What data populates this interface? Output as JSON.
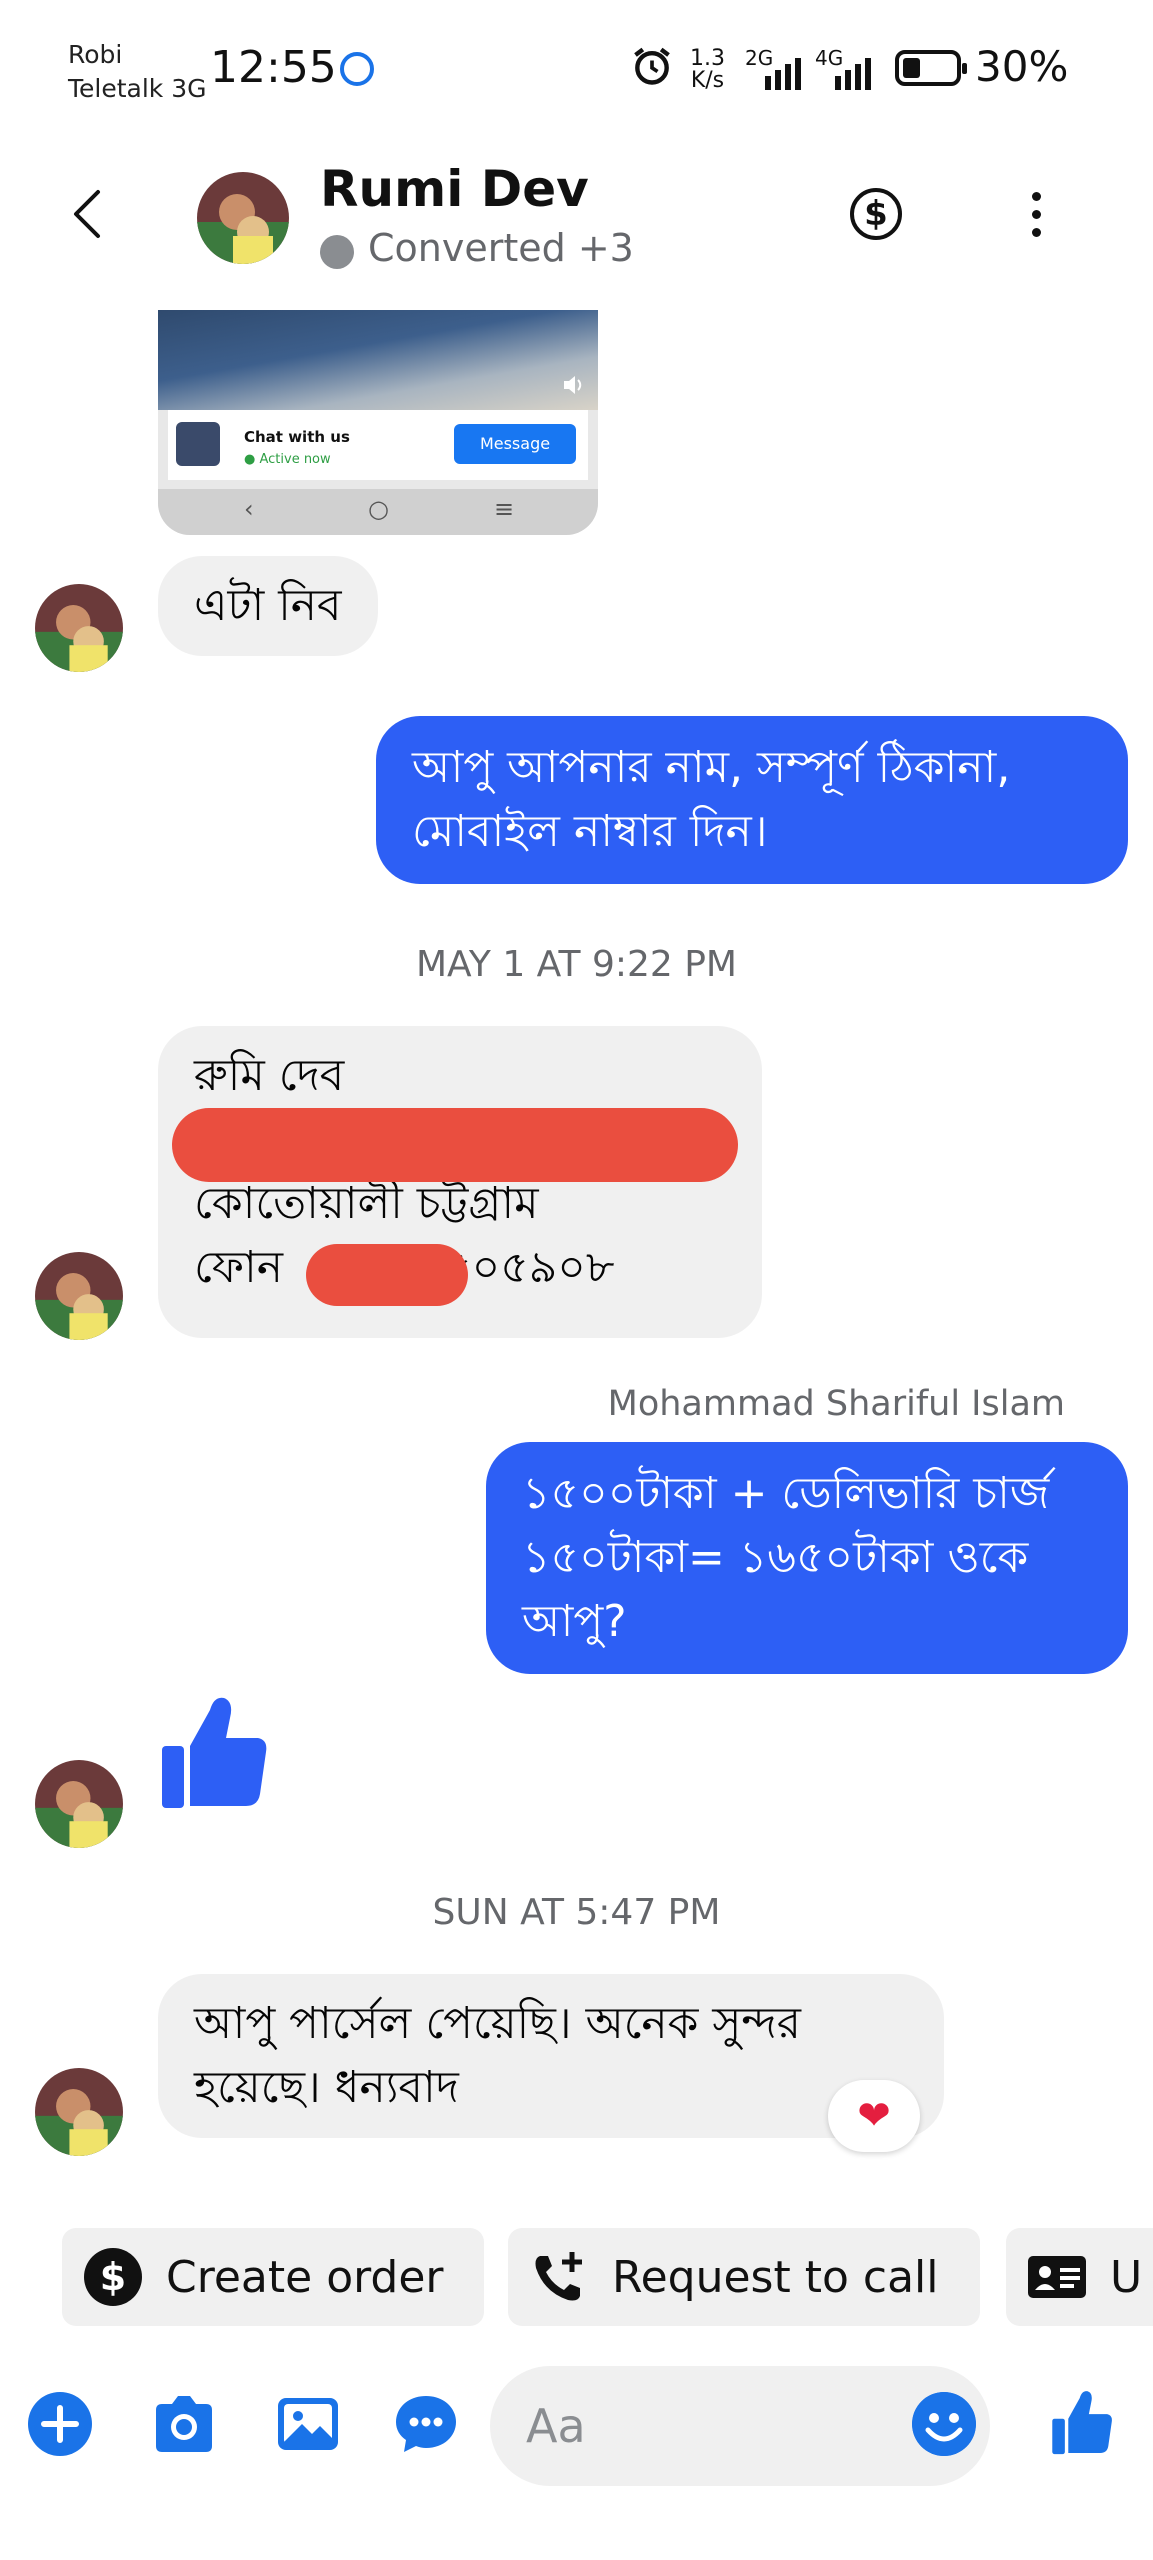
{
  "status_bar": {
    "carrier_1": "Robi",
    "carrier_2": "Teletalk 3G",
    "time": "12:55",
    "net_speed_1": "1.3",
    "net_speed_2": "K/s",
    "sig1_label": "2G",
    "sig2_label": "4G",
    "battery_pct": "30%",
    "battery_level": 0.3
  },
  "header": {
    "title": "Rumi Dev",
    "subtitle": "Converted +3",
    "dollar_symbol": "$"
  },
  "shared_image": {
    "card_title": "Chat with us",
    "card_status": "● Active now",
    "card_button": "Message"
  },
  "messages": {
    "m1": "এটা নিব",
    "m2": "আপু আপনার নাম, সম্পূর্ণ ঠিকানা, মোবাইল নাম্বার দিন।",
    "ts1": "MAY 1 AT 9:22 PM",
    "m3_line1": "রুমি দেব",
    "m3_line3": "কোতোয়ালী চট্টগ্রাম",
    "m3_line4a": "ফোন",
    "m3_line4b": "৫০৫৯০৮",
    "sender": "Mohammad Shariful Islam",
    "m4": "১৫০০টাকা + ডেলিভারি চার্জ ১৫০টাকা= ১৬৫০টাকা ওকে আপু?",
    "ts2": "SUN AT 5:47 PM",
    "m5": "আপু পার্সেল পেয়েছি। অনেক সুন্দর হয়েছে। ধন্যবাদ",
    "reaction": "❤"
  },
  "quick_actions": {
    "create_order": "Create order",
    "request_call": "Request to call",
    "third": "U"
  },
  "composer": {
    "placeholder": "Aa"
  },
  "colors": {
    "outgoing_bubble": "#2d5ff5",
    "incoming_bubble": "#f0f0f0",
    "accent": "#1a73e8"
  }
}
